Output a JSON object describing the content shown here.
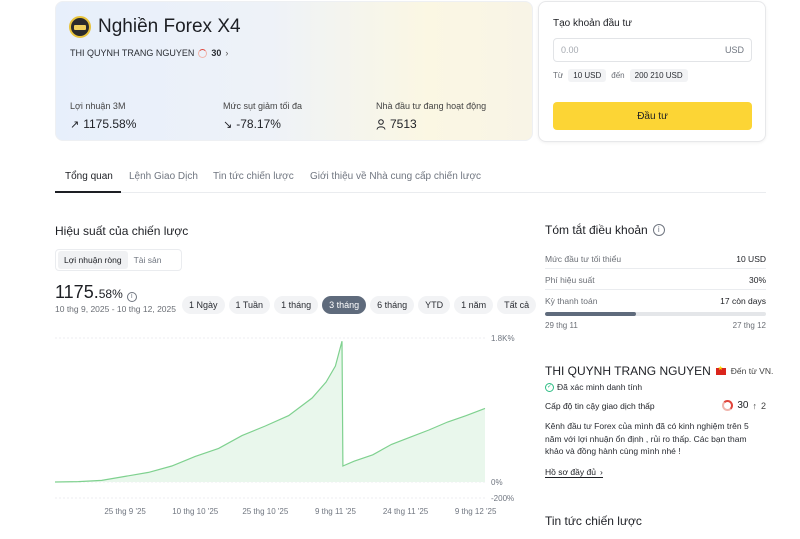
{
  "hero": {
    "title": "Nghiền Forex X4",
    "owner": "THI QUYNH TRANG NGUYEN",
    "owner_score": "30",
    "stats": [
      {
        "label": "Lợi nhuận 3M",
        "value": "1175.58%",
        "icon": "trend-up-icon"
      },
      {
        "label": "Mức sụt giảm tối đa",
        "value": "-78.17%",
        "icon": "arrow-down-right-icon"
      },
      {
        "label": "Nhà đầu tư đang hoạt động",
        "value": "7513",
        "icon": "user-icon"
      }
    ]
  },
  "invest": {
    "title": "Tạo khoản đầu tư",
    "amount_placeholder": "0.00",
    "currency": "USD",
    "from_label": "Từ",
    "min": "10 USD",
    "to_label": "đến",
    "max": "200 210 USD",
    "button": "Đầu tư"
  },
  "tabs": [
    "Tổng quan",
    "Lệnh Giao Dịch",
    "Tin tức chiến lược",
    "Giới thiệu về Nhà cung cấp chiến lược"
  ],
  "performance": {
    "title": "Hiệu suất của chiến lược",
    "segments": [
      "Lợi nhuận ròng",
      "Tài sản"
    ],
    "value_main": "1175.",
    "value_small": "58%",
    "date_range": "10 thg 9, 2025 - 10 thg 12, 2025",
    "periods": [
      "1 Ngày",
      "1 Tuần",
      "1 tháng",
      "3 tháng",
      "6 tháng",
      "YTD",
      "1 năm",
      "Tất cả"
    ]
  },
  "chart_data": {
    "type": "area",
    "y_tick_labels": [
      "1.8K%",
      "0%",
      "-200%"
    ],
    "y_ticks": [
      1800,
      0,
      -200
    ],
    "ylim": [
      -200,
      1800
    ],
    "x_tick_labels": [
      "25 thg 9 '25",
      "10 thg 10 '25",
      "25 thg 10 '25",
      "9 thg 11 '25",
      "24 thg 11 '25",
      "9 thg 12 '25"
    ],
    "x_ticks_day": [
      15,
      30,
      45,
      60,
      75,
      90
    ],
    "xlim": [
      0,
      92
    ],
    "series": [
      {
        "color": "#7fd18f",
        "x": [
          0,
          5,
          10,
          15,
          20,
          25,
          30,
          35,
          40,
          45,
          50,
          55,
          58,
          60,
          61.4,
          61.6,
          64,
          68,
          72,
          76,
          80,
          84,
          88,
          92
        ],
        "y": [
          0,
          5,
          20,
          70,
          120,
          200,
          320,
          420,
          580,
          700,
          830,
          1050,
          1250,
          1450,
          1760,
          200,
          260,
          340,
          470,
          560,
          650,
          750,
          830,
          920
        ]
      }
    ]
  },
  "terms": {
    "title": "Tóm tắt điều khoản",
    "rows": [
      {
        "k": "Mức đầu tư tối thiểu",
        "v": "10 USD"
      },
      {
        "k": "Phí hiệu suất",
        "v": "30%"
      },
      {
        "k": "Kỳ thanh toán",
        "v": "17 còn days"
      }
    ],
    "progress": 0.41,
    "start": "29 thg 11",
    "end": "27 thg 12"
  },
  "provider": {
    "name": "THI QUYNH TRANG NGUYEN",
    "from": "Đến từ VN.",
    "verified": "Đã xác minh danh tính",
    "trust_label": "Cấp độ tin cậy giao dịch thấp",
    "trust_score": "30",
    "trust_change": "2",
    "description": "Kênh đầu tư Forex của mình đã có kinh nghiệm trên 5 năm với lợi nhuận ổn định , rủi ro thấp. Các bạn tham khảo và đồng hành cùng mình nhé !",
    "profile_link": "Hồ sơ đầy đủ"
  },
  "news": {
    "title": "Tin tức chiến lược"
  }
}
